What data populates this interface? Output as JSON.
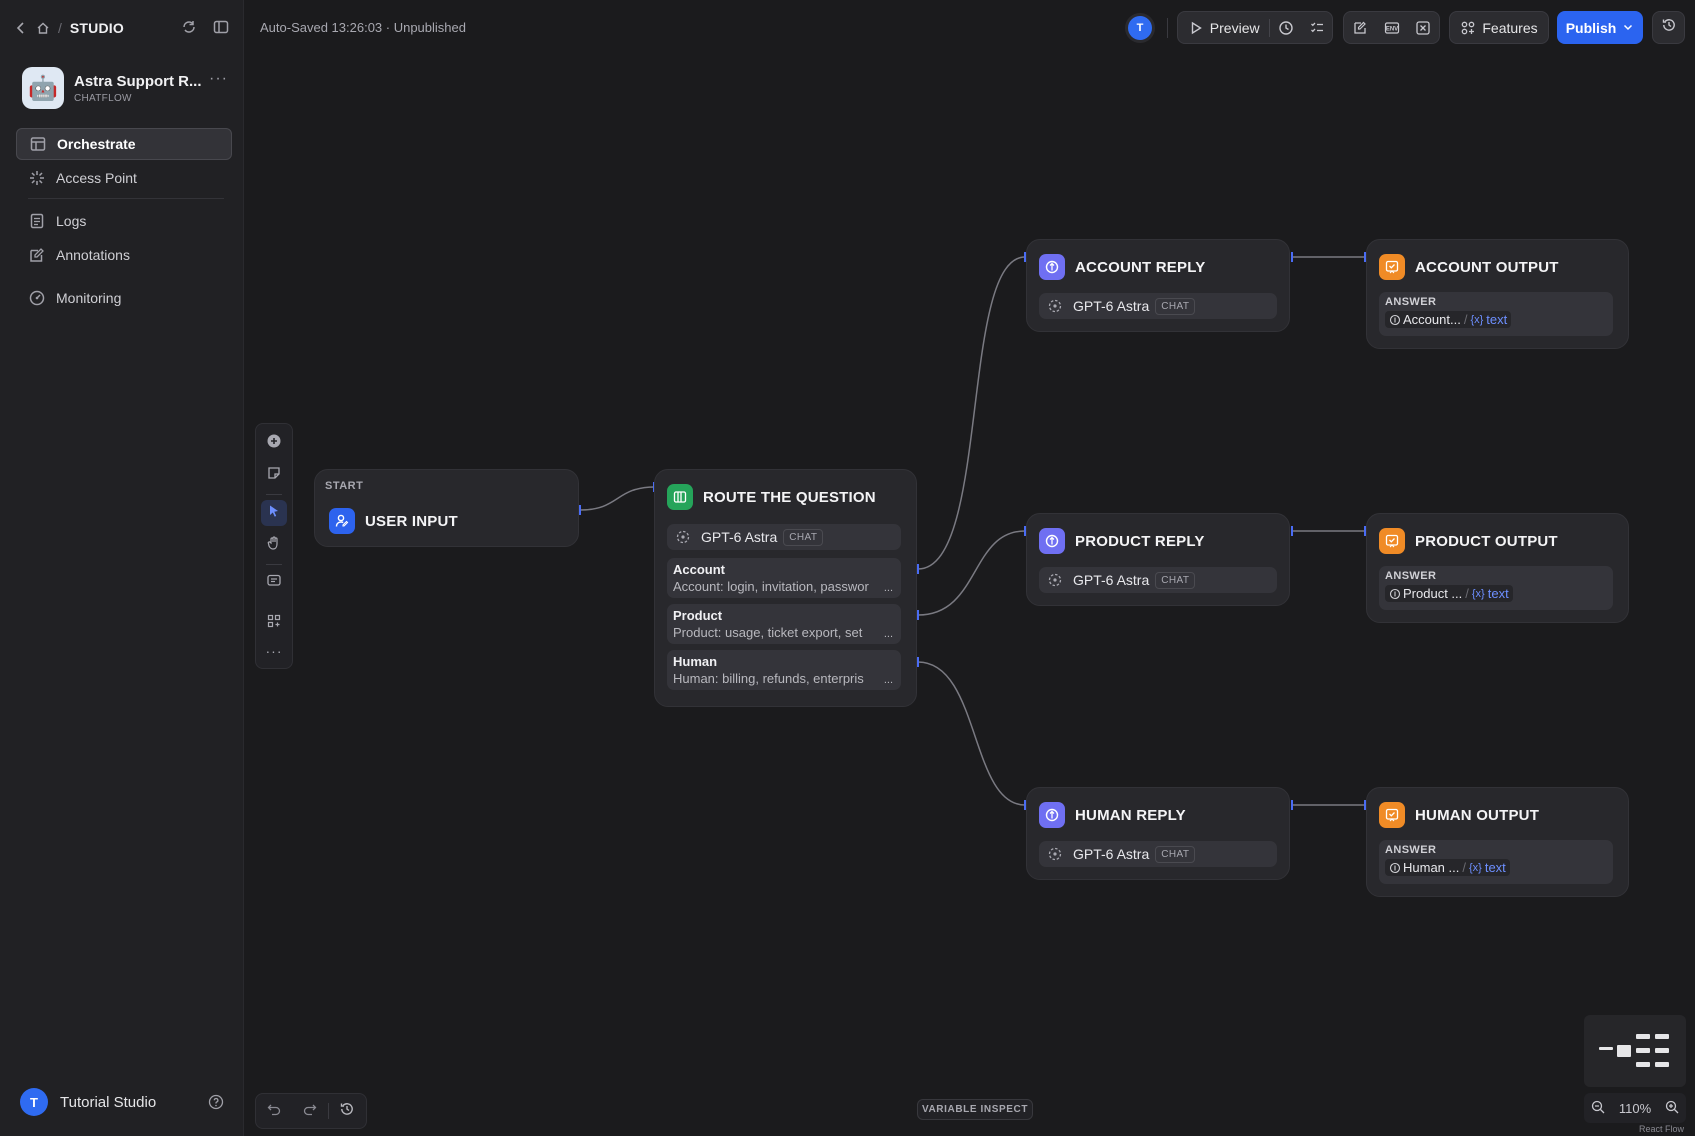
{
  "breadcrumb": {
    "studio": "STUDIO"
  },
  "app": {
    "name": "Astra Support R...",
    "type": "CHATFLOW",
    "icon": "robot-icon"
  },
  "nav": {
    "orchestrate": "Orchestrate",
    "access_point": "Access Point",
    "logs": "Logs",
    "annotations": "Annotations",
    "monitoring": "Monitoring"
  },
  "user": {
    "initial": "T",
    "name": "Tutorial Studio"
  },
  "topbar": {
    "autosave": "Auto-Saved 13:26:03 · Unpublished",
    "avatar_initial": "T",
    "preview": "Preview",
    "features": "Features",
    "publish": "Publish",
    "env_label": "ENV"
  },
  "nodes": {
    "start": {
      "label": "START",
      "title": "USER INPUT"
    },
    "router": {
      "title": "ROUTE THE QUESTION",
      "model": "GPT-6 Astra",
      "chip": "CHAT",
      "classes": [
        {
          "name": "Account",
          "desc": "Account: login, invitation, passwor"
        },
        {
          "name": "Product",
          "desc": "Product: usage, ticket export, set"
        },
        {
          "name": "Human",
          "desc": "Human: billing, refunds, enterpris"
        }
      ],
      "ellipsis": "..."
    },
    "account_reply": {
      "title": "ACCOUNT REPLY",
      "model": "GPT-6 Astra",
      "chip": "CHAT"
    },
    "product_reply": {
      "title": "PRODUCT REPLY",
      "model": "GPT-6 Astra",
      "chip": "CHAT"
    },
    "human_reply": {
      "title": "HUMAN REPLY",
      "model": "GPT-6 Astra",
      "chip": "CHAT"
    },
    "account_output": {
      "title": "ACCOUNT OUTPUT",
      "answer_label": "ANSWER",
      "ref_node": "Account...",
      "var_sym": "{x}",
      "var_name": "text"
    },
    "product_output": {
      "title": "PRODUCT OUTPUT",
      "answer_label": "ANSWER",
      "ref_node": "Product ...",
      "var_sym": "{x}",
      "var_name": "text"
    },
    "human_output": {
      "title": "HUMAN OUTPUT",
      "answer_label": "ANSWER",
      "ref_node": "Human ...",
      "var_sym": "{x}",
      "var_name": "text"
    }
  },
  "bottom": {
    "variable_inspect": "VARIABLE INSPECT",
    "zoom": "110%",
    "attribution": "React Flow"
  },
  "colors": {
    "accent": "#2b64f0",
    "edge": "#7a7a82",
    "handle": "#4a6cf5",
    "llm_badge": "#6f6ff2",
    "answer_badge": "#f08b26",
    "classifier_badge": "#25a45a"
  }
}
